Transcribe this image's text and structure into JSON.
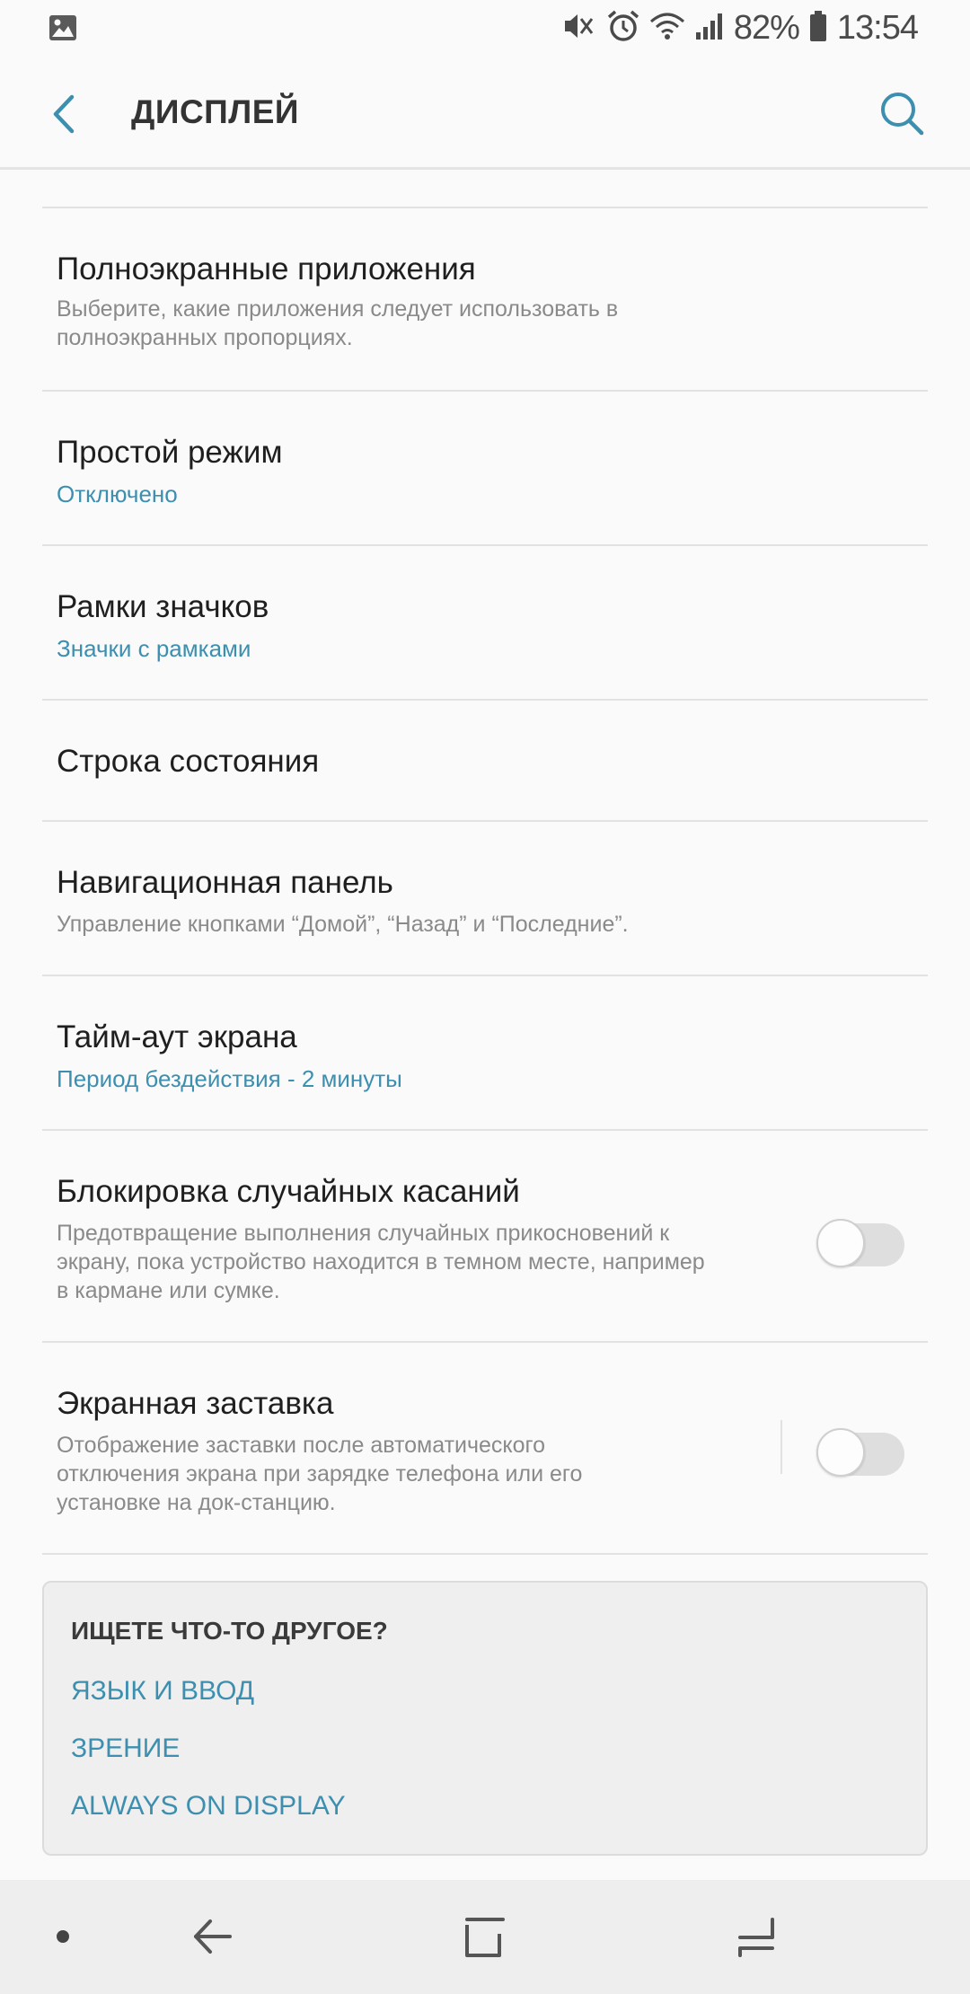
{
  "status_bar": {
    "battery_percent": "82%",
    "time": "13:54",
    "icons": [
      "gallery-notification-icon",
      "mute-icon",
      "alarm-icon",
      "wifi-icon",
      "signal-icon",
      "battery-icon"
    ]
  },
  "app_bar": {
    "title": "ДИСПЛЕЙ",
    "icons": [
      "back-arrow-icon",
      "search-icon"
    ]
  },
  "settings": [
    {
      "title": "Полноэкранные приложения",
      "subtitle": "Выберите, какие приложения следует использовать в полноэкранных пропорциях."
    },
    {
      "title": "Простой режим",
      "value": "Отключено"
    },
    {
      "title": "Рамки значков",
      "value": "Значки с рамками"
    },
    {
      "title": "Строка состояния"
    },
    {
      "title": "Навигационная панель",
      "subtitle": "Управление кнопками “Домой”, “Назад” и “Последние”."
    },
    {
      "title": "Тайм-аут экрана",
      "value": "Период бездействия - 2 минуты"
    },
    {
      "title": "Блокировка случайных касаний",
      "subtitle_lines": [
        "Предотвращение выполнения случайных прикосновений к",
        "экрану, пока устройство находится в темном месте, например",
        "в кармане или сумке."
      ],
      "toggle_on": false
    },
    {
      "title": "Экранная заставка",
      "subtitle_lines": [
        "Отображение заставки после автоматического",
        "отключения экрана при зарядке телефона или его",
        "установке на док-станцию."
      ],
      "toggle_on": false
    }
  ],
  "suggestions": {
    "title": "ИЩЕТЕ ЧТО-ТО ДРУГОЕ?",
    "links": [
      "ЯЗЫК И ВВОД",
      "ЗРЕНИЕ",
      "ALWAYS ON DISPLAY"
    ]
  },
  "nav_bar": {
    "icons": [
      "dot-icon",
      "back-icon",
      "home-icon",
      "recents-icon"
    ]
  },
  "colors": {
    "accent": "#3d8fb0",
    "background": "#fafafa",
    "nav_bar": "#eeeeee"
  }
}
